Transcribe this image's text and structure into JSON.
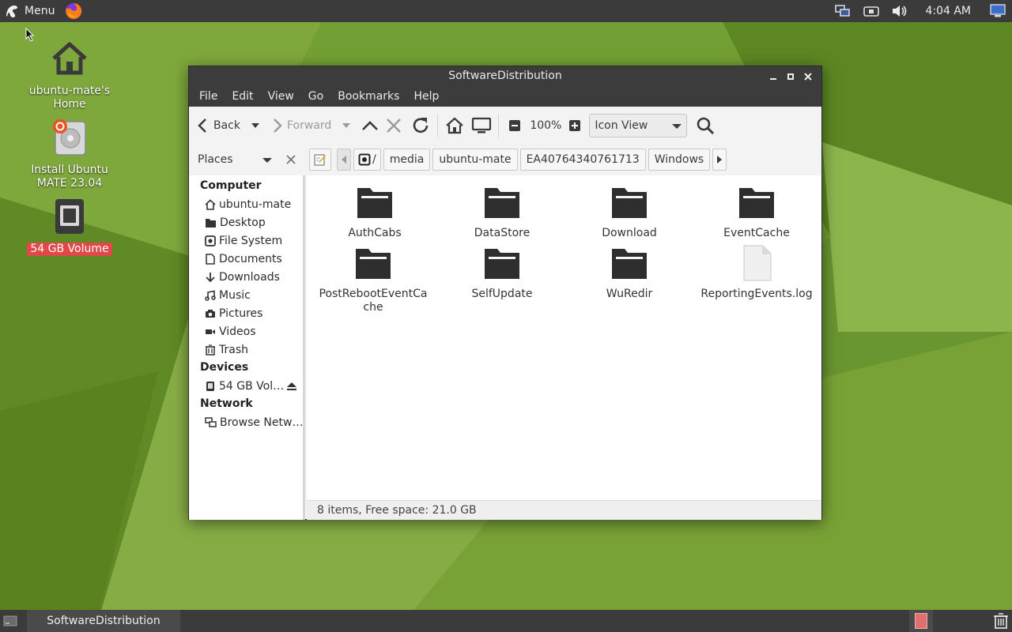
{
  "top_panel": {
    "menu_label": "Menu",
    "clock": "4:04 AM",
    "tray_icons": [
      "network-icon",
      "keyboard-icon",
      "volume-icon",
      "display-icon"
    ]
  },
  "desktop": {
    "icons": [
      {
        "label": "ubuntu-mate's Home",
        "icon": "home-icon",
        "selected": false
      },
      {
        "label": "Install Ubuntu MATE 23.04",
        "icon": "installer-icon",
        "selected": false
      },
      {
        "label": "54 GB Volume",
        "icon": "drive-icon",
        "selected": true
      }
    ]
  },
  "window": {
    "title": "SoftwareDistribution",
    "menubar": [
      "File",
      "Edit",
      "View",
      "Go",
      "Bookmarks",
      "Help"
    ],
    "toolbar": {
      "back_label": "Back",
      "forward_label": "Forward",
      "zoom": "100%",
      "view_mode": "Icon View"
    },
    "places_label": "Places",
    "path_root": "/",
    "path": [
      "media",
      "ubuntu-mate",
      "EA40764340761713",
      "Windows"
    ],
    "sidebar": {
      "computer_header": "Computer",
      "computer_items": [
        {
          "label": "ubuntu-mate",
          "icon": "home-icon"
        },
        {
          "label": "Desktop",
          "icon": "folder-icon"
        },
        {
          "label": "File System",
          "icon": "filesystem-icon"
        },
        {
          "label": "Documents",
          "icon": "document-icon"
        },
        {
          "label": "Downloads",
          "icon": "download-icon"
        },
        {
          "label": "Music",
          "icon": "music-icon"
        },
        {
          "label": "Pictures",
          "icon": "camera-icon"
        },
        {
          "label": "Videos",
          "icon": "video-icon"
        },
        {
          "label": "Trash",
          "icon": "trash-icon"
        }
      ],
      "devices_header": "Devices",
      "device_item": "54 GB Vol…",
      "network_header": "Network",
      "network_item": "Browse Netw…"
    },
    "files": [
      {
        "name": "AuthCabs",
        "type": "folder"
      },
      {
        "name": "DataStore",
        "type": "folder"
      },
      {
        "name": "Download",
        "type": "folder"
      },
      {
        "name": "EventCache",
        "type": "folder"
      },
      {
        "name": "PostRebootEventCa\nche",
        "type": "folder"
      },
      {
        "name": "SelfUpdate",
        "type": "folder"
      },
      {
        "name": "WuRedir",
        "type": "folder"
      },
      {
        "name": "ReportingEvents.log",
        "type": "file"
      }
    ],
    "status": "8 items, Free space: 21.0 GB"
  },
  "bottom_panel": {
    "task_label": "SoftwareDistribution"
  }
}
